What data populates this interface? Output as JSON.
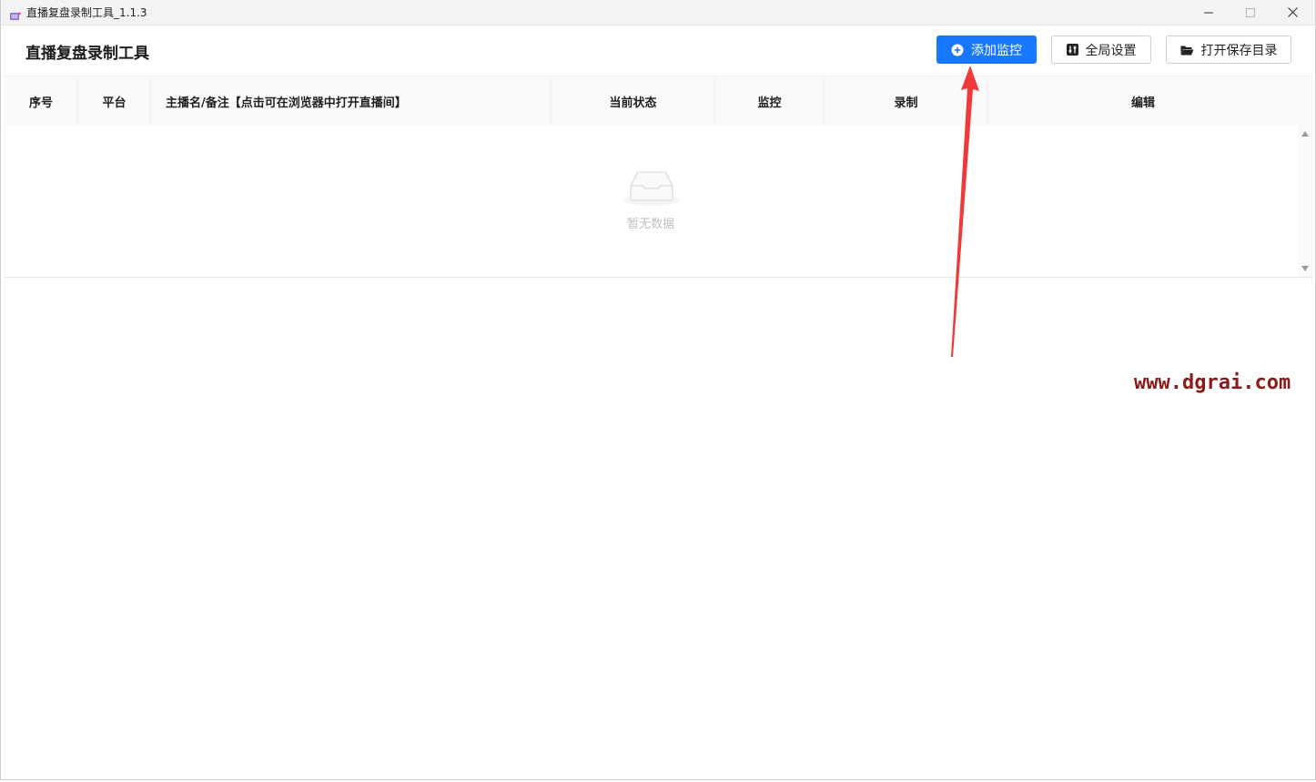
{
  "window": {
    "title": "直播复盘录制工具_1.1.3"
  },
  "header": {
    "app_title": "直播复盘录制工具",
    "buttons": {
      "add_monitor": "添加监控",
      "global_settings": "全局设置",
      "open_save_dir": "打开保存目录"
    }
  },
  "table": {
    "columns": {
      "index": "序号",
      "platform": "平台",
      "anchor": "主播名/备注【点击可在浏览器中打开直播间】",
      "status": "当前状态",
      "monitor": "监控",
      "record": "录制",
      "edit": "编辑"
    },
    "rows": [],
    "empty_text": "暂无数据"
  },
  "overlay": {
    "watermark": "www.dgrai.com",
    "arrow_color": "#f03a3a"
  },
  "colors": {
    "primary": "#1677ff",
    "watermark": "#8b1b1b"
  },
  "icons": {
    "app": "app-icon",
    "add": "plus-circle-icon",
    "settings": "sliders-icon",
    "folder": "folder-open-icon",
    "empty": "empty-inbox-icon"
  }
}
